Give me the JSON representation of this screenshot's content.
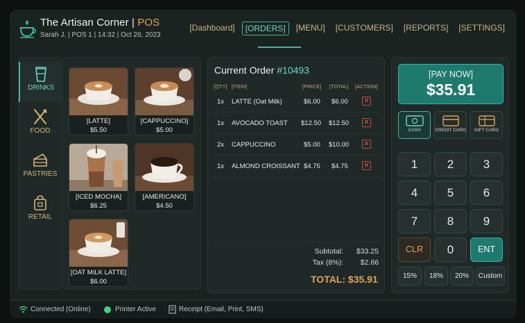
{
  "header": {
    "app_name": "The Artisan Corner | ",
    "app_suffix": "POS",
    "session": "Sarah J. | POS 1 | 14:32 | Oct 26, 2023"
  },
  "nav": [
    {
      "label": "[Dashboard]"
    },
    {
      "label": "[ORDERS]",
      "active": true
    },
    {
      "label": "[MENU]"
    },
    {
      "label": "[CUSTOMERS]"
    },
    {
      "label": "[REPORTS]"
    },
    {
      "label": "[SETTINGS]"
    }
  ],
  "categories": [
    {
      "label": "DRINKS",
      "icon": "cup-icon",
      "active": true
    },
    {
      "label": "FOOD",
      "icon": "fork-knife-icon"
    },
    {
      "label": "PASTRIES",
      "icon": "cake-slice-icon"
    },
    {
      "label": "RETAIL",
      "icon": "shop-bag-icon"
    }
  ],
  "products": [
    {
      "name": "[LATTE]",
      "price": "$5.50"
    },
    {
      "name": "[CAPPUCCINO]",
      "price": "$5.00"
    },
    {
      "name": "[ICED MOCHA]",
      "price": "$6.25"
    },
    {
      "name": "[AMERICANO]",
      "price": "$4.50"
    },
    {
      "name": "[OAT MILK LATTE]",
      "price": "$6.00"
    }
  ],
  "order": {
    "title": "Current Order ",
    "number": "#10493",
    "columns": {
      "qty": "[QTY]",
      "item": "[ITEM]",
      "price": "[PRICE]",
      "total": "[TOTAL]",
      "action": "[ACTION]"
    },
    "items": [
      {
        "qty": "1x",
        "item": "LATTE (Oat Milk)",
        "price": "$6.00",
        "total": "$6.00"
      },
      {
        "qty": "1x",
        "item": "AVOCADO TOAST",
        "price": "$12.50",
        "total": "$12.50"
      },
      {
        "qty": "2x",
        "item": "CAPPUCCINO",
        "price": "$5.00",
        "total": "$10.00"
      },
      {
        "qty": "1x",
        "item": "ALMOND CROISSANT",
        "price": "$4.75",
        "total": "$4.75"
      }
    ],
    "subtotal_label": "Subtotal:",
    "subtotal": "$33.25",
    "tax_label": "Tax (8%):",
    "tax": "$2.66",
    "total_label": "TOTAL: $35.91"
  },
  "payment": {
    "pay_label": "[PAY NOW]",
    "pay_amount": "$35.91",
    "methods": [
      {
        "label": "CASH",
        "icon": "cash-icon",
        "active": true
      },
      {
        "label": "CREDIT CARD",
        "icon": "credit-card-icon"
      },
      {
        "label": "GIFT CARD",
        "icon": "gift-card-icon"
      }
    ],
    "keys": [
      "1",
      "2",
      "3",
      "4",
      "5",
      "6",
      "7",
      "8",
      "9",
      "CLR",
      "0",
      "ENT"
    ],
    "tips": [
      "15%",
      "18%",
      "20%",
      "Custom"
    ]
  },
  "status": {
    "connection": "Connected (Online)",
    "printer": "Printer Active",
    "receipt": "Receipt (Email, Print, SMS)"
  },
  "colors": {
    "accent": "#4ab3a6",
    "gold": "#e0a458",
    "danger": "#e0584b"
  }
}
